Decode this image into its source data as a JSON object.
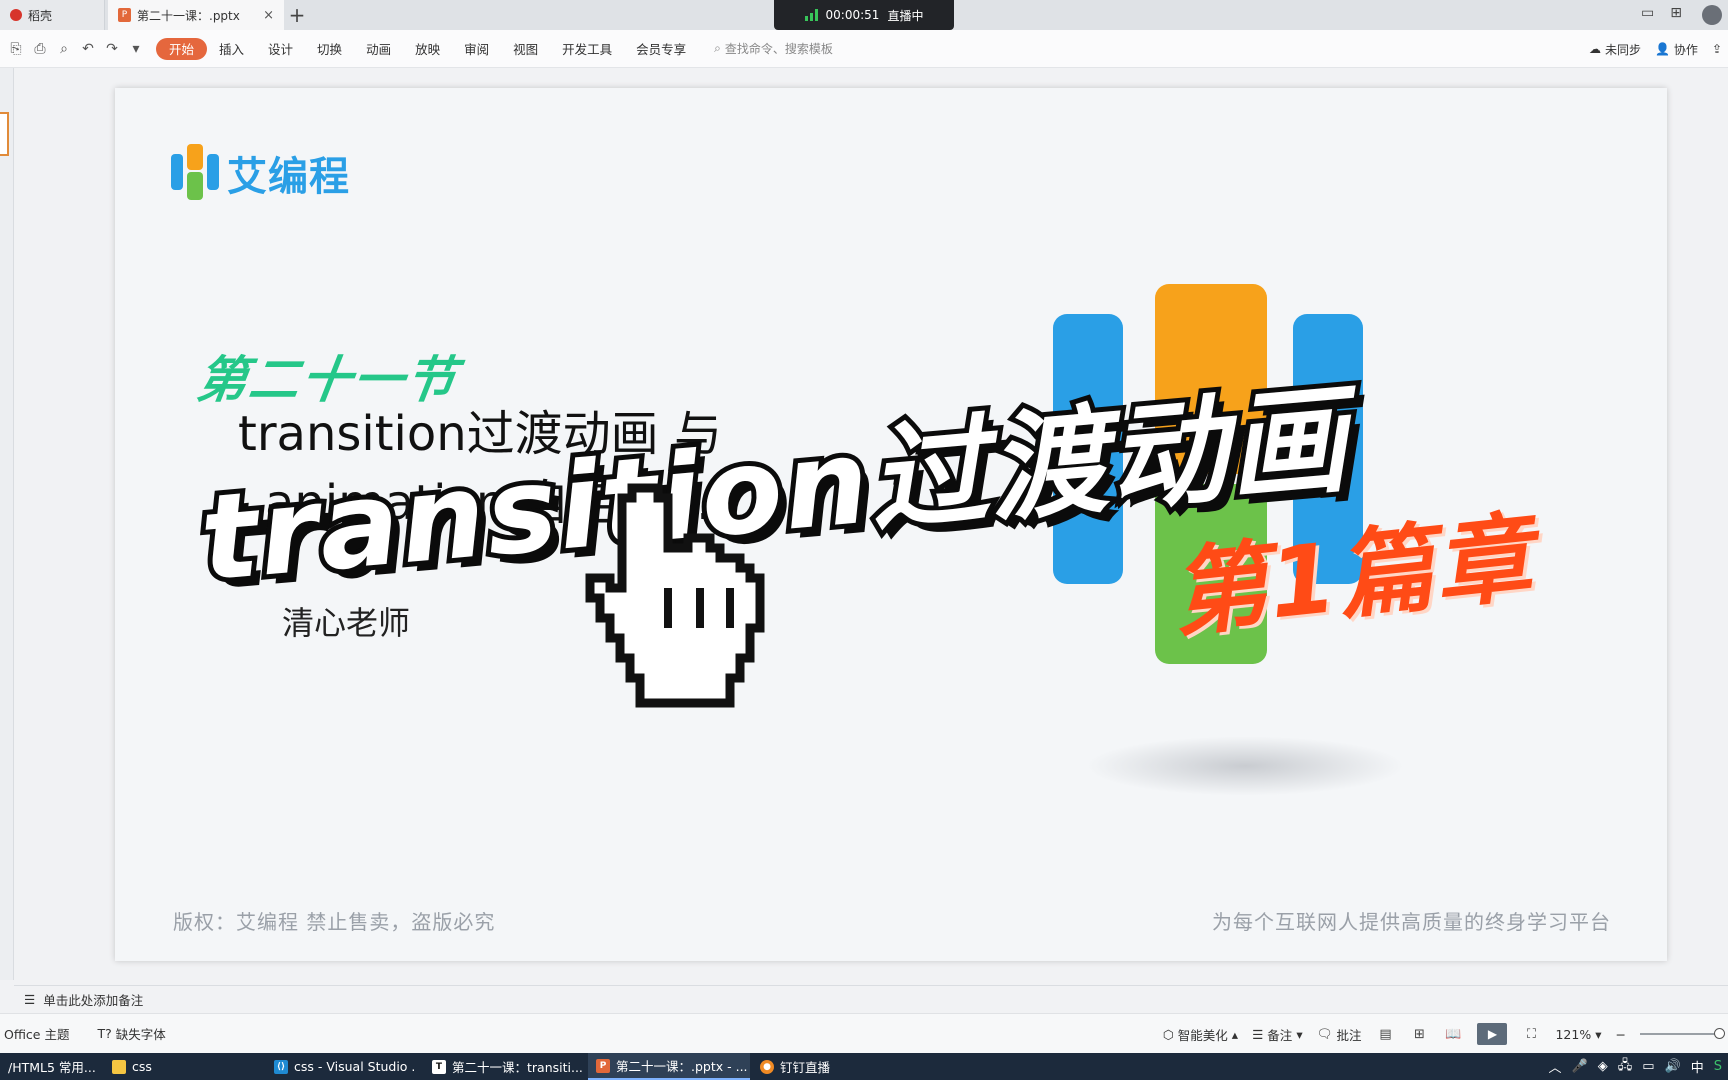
{
  "tabs": [
    {
      "label": "稻壳"
    },
    {
      "label": "第二十一课：.pptx"
    }
  ],
  "live": {
    "time": "00:00:51",
    "status": "直播中"
  },
  "ribbon": {
    "menu": [
      "开始",
      "插入",
      "设计",
      "切换",
      "动画",
      "放映",
      "审阅",
      "视图",
      "开发工具",
      "会员专享"
    ],
    "search_placeholder": "查找命令、搜索模板",
    "sync": "未同步",
    "collab": "协作"
  },
  "slide": {
    "brand": "艾编程",
    "section_title": "第二十一节",
    "subtitle_line1": "transition过渡动画 与",
    "subtitle_line2": "animation 自定义...",
    "teacher": "清心老师",
    "banner": "transition过渡动画",
    "chapter": "第1篇章",
    "footer_left": "版权：艾编程   禁止售卖，盗版必究",
    "footer_right": "为每个互联网人提供高质量的终身学习平台"
  },
  "notes_placeholder": "单击此处添加备注",
  "status": {
    "theme": "Office 主题",
    "missing_font": "缺失字体",
    "beautify": "智能美化",
    "notes": "备注",
    "comment": "批注",
    "zoom": "121%"
  },
  "taskbar": [
    {
      "label": "/HTML5 常用..."
    },
    {
      "label": "css"
    },
    {
      "label": "css - Visual Studio ..."
    },
    {
      "label": "第二十一课：transiti..."
    },
    {
      "label": "第二十一课：.pptx - ..."
    },
    {
      "label": "钉钉直播"
    }
  ],
  "tray": {
    "ime": "中"
  },
  "colors": {
    "accent": "#e5673d",
    "brand_blue": "#2a9fe6",
    "section_green": "#25c789",
    "chapter_orange": "#ff4b16"
  }
}
